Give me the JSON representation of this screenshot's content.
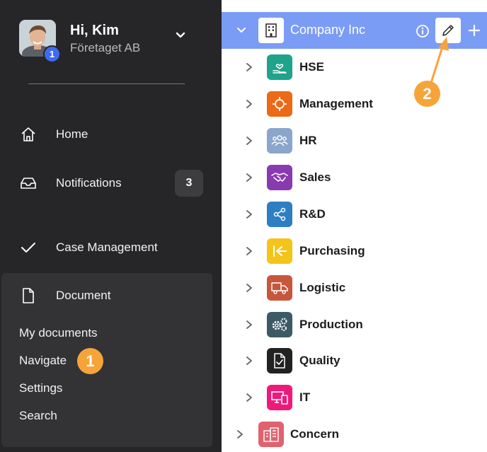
{
  "profile": {
    "greeting": "Hi, Kim",
    "company": "Företaget AB",
    "avatar_badge": "1"
  },
  "nav": {
    "home": "Home",
    "notifications": "Notifications",
    "notifications_count": "3",
    "case_management": "Case Management",
    "document": "Document",
    "sub_items": [
      "My documents",
      "Navigate",
      "Settings",
      "Search"
    ]
  },
  "callouts": {
    "first": "1",
    "second": "2"
  },
  "tree": {
    "root_label": "Company Inc",
    "items": [
      {
        "label": "HSE",
        "color": "#1fa38a",
        "icon": "hand-heart-icon"
      },
      {
        "label": "Management",
        "color": "#ec6a17",
        "icon": "target-icon"
      },
      {
        "label": "HR",
        "color": "#8ba6cc",
        "icon": "people-icon"
      },
      {
        "label": "Sales",
        "color": "#8a3ab1",
        "icon": "handshake-icon"
      },
      {
        "label": "R&D",
        "color": "#2d7ec2",
        "icon": "share-icon"
      },
      {
        "label": "Purchasing",
        "color": "#f3c41a",
        "icon": "arrow-in-icon"
      },
      {
        "label": "Logistic",
        "color": "#c6573c",
        "icon": "truck-icon"
      },
      {
        "label": "Production",
        "color": "#3c5a66",
        "icon": "gears-icon"
      },
      {
        "label": "Quality",
        "color": "#222222",
        "icon": "doc-check-icon"
      },
      {
        "label": "IT",
        "color": "#ee1a7a",
        "icon": "devices-icon"
      }
    ],
    "concern_label": "Concern",
    "concern_color": "#e0626e"
  },
  "colors": {
    "sidebar_bg": "#262628",
    "selected_row": "#7b9cf4",
    "callout": "#f6a43a",
    "accent_blue": "#3f6bf0"
  }
}
